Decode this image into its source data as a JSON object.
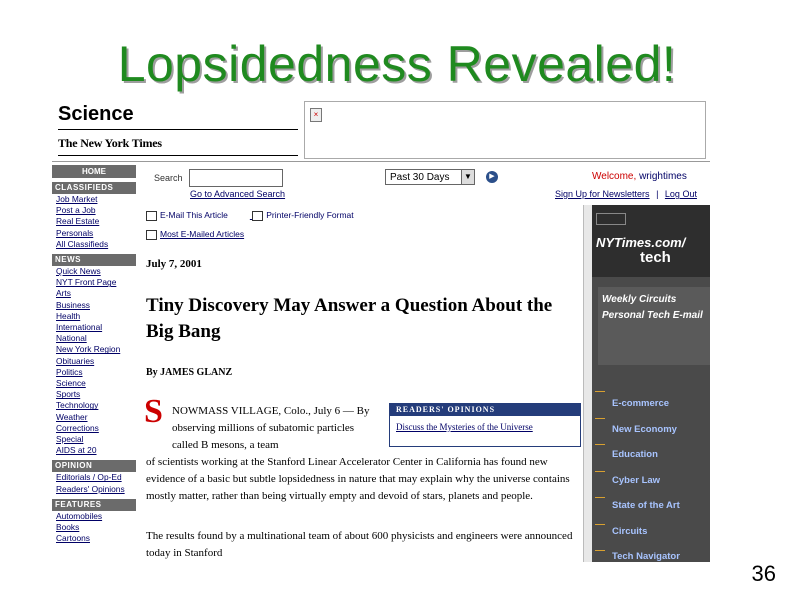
{
  "slide": {
    "title": "Lopsidedness Revealed!",
    "page_number": "36"
  },
  "header": {
    "section": "Science",
    "logo": "The New York Times"
  },
  "sidebar": {
    "home": "HOME",
    "classifieds": {
      "heading": "CLASSIFIEDS",
      "items": [
        "Job Market",
        "Post a Job",
        "Real Estate",
        "Personals",
        "All Classifieds"
      ]
    },
    "news": {
      "heading": "NEWS",
      "items": [
        "Quick News",
        "NYT Front Page",
        "Arts",
        "Business",
        "Health",
        "International",
        "National",
        "New York Region",
        "Obituaries",
        "Politics",
        "Science",
        "Sports",
        "Technology",
        "Weather",
        "Corrections",
        "Special",
        "AIDS at 20"
      ]
    },
    "opinion": {
      "heading": "OPINION",
      "items": [
        "Editorials / Op-Ed",
        "Readers' Opinions"
      ]
    },
    "features": {
      "heading": "FEATURES",
      "items": [
        "Automobiles",
        "Books",
        "Cartoons"
      ]
    }
  },
  "search": {
    "label": "Search",
    "value": "",
    "range_selected": "Past 30 Days",
    "advanced_link": "Go to Advanced Search"
  },
  "account": {
    "welcome_prefix": "Welcome,",
    "username": "wrightimes",
    "newsletters_link": "Sign Up for Newsletters",
    "separator": "|",
    "logout_link": "Log Out"
  },
  "article": {
    "email_link": "E-Mail This Article",
    "print_link": "Printer-Friendly Format",
    "most_emailed_link": "Most E-Mailed Articles",
    "date": "July 7, 2001",
    "headline": "Tiny Discovery May Answer a Question About the Big Bang",
    "byline": "By JAMES GLANZ",
    "dropcap": "S",
    "lead_wrapped": "NOWMASS VILLAGE, Colo., July 6 — By observing millions of subatomic particles called B mesons, a team",
    "lead_full": "of scientists working at the Stanford Linear Accelerator Center in California has found new evidence of a basic but subtle lopsidedness in nature that may explain why the universe contains mostly matter, rather than being virtually empty and devoid of stars, planets and people.",
    "second_para": "The results found by a multinational team of about 600 physicists and engineers were announced today in Stanford",
    "readers_box": {
      "heading": "READERS' OPINIONS",
      "link": "Discuss the Mysteries of the Universe"
    }
  },
  "tech_panel": {
    "brand": "NYTimes.com/",
    "section": "tech",
    "promo1": "Weekly Circuits",
    "promo2": "Personal Tech E-mail",
    "items": [
      "E-commerce",
      "New Economy",
      "Education",
      "Cyber Law",
      "State of the Art",
      "Circuits",
      "Tech Navigator"
    ]
  },
  "colors": {
    "title_green": "#1f8a1f",
    "nyt_blue": "#000066",
    "welcome_red": "#cc0000",
    "readers_navy": "#243c7a",
    "tech_panel": "#4a4a4a"
  }
}
